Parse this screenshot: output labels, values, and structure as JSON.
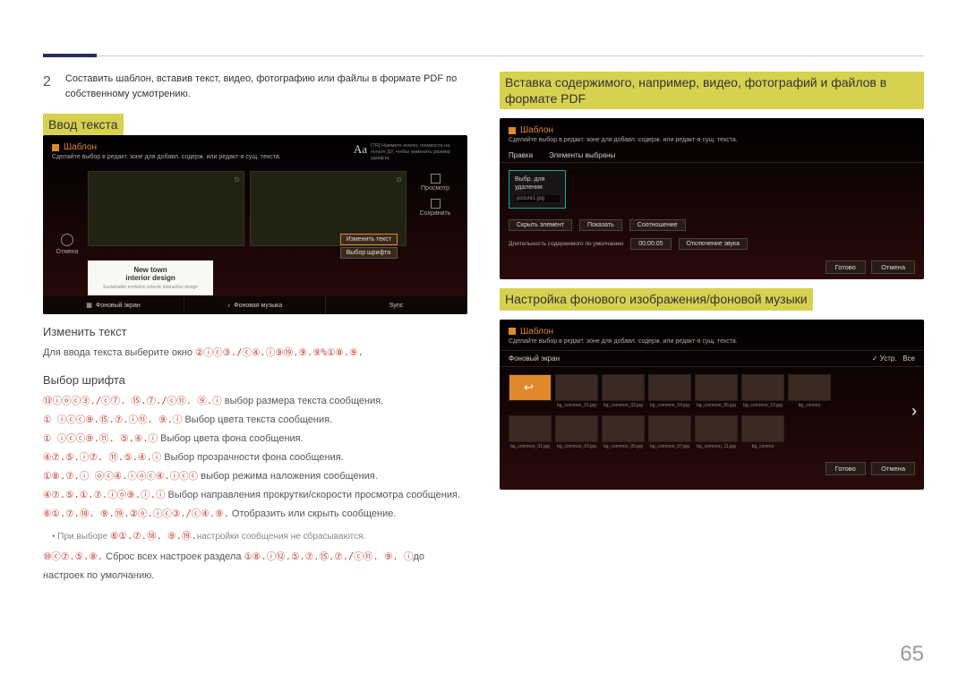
{
  "step": {
    "num": "2",
    "text": "Составить шаблон, вставив текст, видео, фотографию или файлы в формате PDF по собственному усмотрению."
  },
  "left": {
    "h_input": "Ввод текста",
    "h_edit": "Изменить текст",
    "edit_body_pre": "Для ввода текста выберите окно ",
    "edit_body_red": "②ⓘⓒ③./ⓒ④.ⓘ⑨⑲.⑨.⑨%①⑧.⑨.",
    "h_font": "Выбор шрифта",
    "lines": [
      {
        "red": "⑬ⓘⓞⓒ③./ⓒ⑦. ⑮.⑦./ⓒ⑪. ⑨.ⓘ",
        "txt": " выбор размера текста сообщения."
      },
      {
        "red": "① ⓘⓒⓒ⑨.⑮.⑦.ⓘ⑪. ⑨.ⓘ",
        "txt": " Выбор цвета текста сообщения."
      },
      {
        "red": "① ⓘⓒⓒ⑨.⑪. ⑤.④.ⓘ",
        "txt": " Выбор цвета фона сообщения."
      },
      {
        "red": "④⑦.⑤.ⓘ⑦. ⑪.⑤.④.ⓘ",
        "txt": " Выбор прозрачности фона сообщения."
      },
      {
        "red": "①⑧.⑦.ⓘ ⓞⓒ④.ⓘⓞⓒ④.ⓘⓒⓒ",
        "txt": " выбор режима наложения сообщения."
      },
      {
        "red": "④⑦.⑤.①.⑦.ⓘⓞ⑨.ⓘ.ⓘ",
        "txt": " Выбор направления прокрутки/скорости просмотра сообщения."
      },
      {
        "red": "⑥①.⑦.⑱. ⑨.⑲.②ⓞ.ⓘⓒ③./ⓒ④.⑨.",
        "txt": " Отобразить или скрыть сообщение."
      }
    ],
    "bullet_pre": "При выборе ",
    "bullet_red": "⑥①.⑦.⑱. ⑨.⑲.",
    "bullet_post": "настройки сообщения не сбрасываются.",
    "reset_red": "⑩ⓒ⑦.⑤.⑧.",
    "reset_mid": " Сброс всех настроек раздела ",
    "reset_red2": "①⑧.ⓘ⑫.⑤.⑦.⑮.⑦./ⓒ⑪. ⑨. ⓘ",
    "reset_post": "до настроек по умолчанию."
  },
  "right": {
    "h_insert": "Вставка содержимого, например, видео, фотографий и файлов в формате PDF",
    "h_bg": "Настройка фонового изображения/фоновой музыки"
  },
  "shot_common": {
    "title": "Шаблон",
    "done": "Готово",
    "cancel": "Отмена"
  },
  "shot1": {
    "sub": "Сделайте выбор в редакт. зоне для добавл. содерж. или редакт-я сущ. текста.",
    "Aa": "Aa",
    "Aa_txt": "[TR] Нажмите кнопку громкости на пульте ДУ, чтобы изменить размер шрифта",
    "cancel_left": "Отмена",
    "preview": "Просмотр",
    "save": "Сохранить",
    "white": {
      "t1": "New town",
      "t2": "interior design",
      "t3": "Sustainable evolution eclectic interactive design"
    },
    "mini1": "Изменить текст",
    "mini2": "Выбор шрифта",
    "bb1": "Фоновый экран",
    "bb2": "Фоновая музыка",
    "bb3": "Sync"
  },
  "shot2": {
    "sub": "Сделайте выбор в редакт. зоне для добавл. содерж. или редакт-я сущ. текста.",
    "tab1": "Правка",
    "tab2": "Элементы выбраны",
    "sel_label": "Выбр. для удаления",
    "sel_file": "picture1.jpg",
    "hide": "Скрыть элемент",
    "show": "Показать",
    "ratio": "Соотношение",
    "dur_label": "Длительность содержимого по умолчанию",
    "dur_val": "00:00:05",
    "mute": "Отключение звука"
  },
  "shot3": {
    "sub": "Сделайте выбор в редакт. зоне для добавл. содерж. или редакт-я сущ. текста.",
    "hdr": "Фоновый экран",
    "device": "Устр.",
    "all": "Все",
    "thumbs_row1": [
      "bg_common_01.jpg",
      "bg_common_03.jpg",
      "bg_common_04.jpg",
      "bg_common_06.jpg",
      "bg_common_10.jpg",
      "bg_commo"
    ],
    "thumbs_row2": [
      "bg_common_01.jpg",
      "bg_common_03.jpg",
      "bg_common_05.jpg",
      "bg_common_07.jpg",
      "bg_common_11.jpg",
      "bg_commo"
    ]
  },
  "page_num": "65"
}
